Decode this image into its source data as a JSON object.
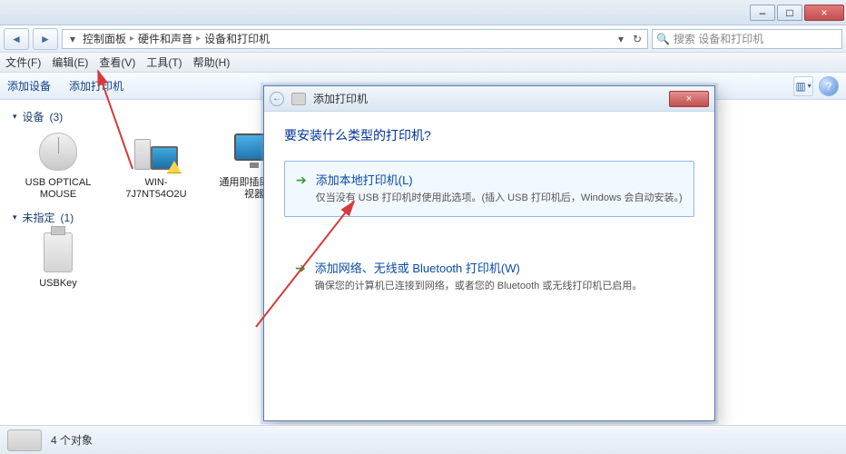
{
  "window": {
    "min": "–",
    "max": "□",
    "close": "×"
  },
  "nav": {
    "back": "◄",
    "fwd": "►",
    "crumbs": [
      "控制面板",
      "硬件和声音",
      "设备和打印机"
    ],
    "refresh": "↻",
    "search_placeholder": "搜索 设备和打印机"
  },
  "menu": [
    "文件(F)",
    "编辑(E)",
    "查看(V)",
    "工具(T)",
    "帮助(H)"
  ],
  "toolbar": {
    "add_device": "添加设备",
    "add_printer": "添加打印机",
    "view_icon": "▥",
    "help": "?"
  },
  "groups": {
    "devices": {
      "label": "设备",
      "count": "(3)"
    },
    "unspecified": {
      "label": "未指定",
      "count": "(1)"
    }
  },
  "devices": {
    "mouse": "USB OPTICAL MOUSE",
    "pc": "WIN-7J7NT54O2U",
    "monitor": "通用即插即用监视器",
    "usbkey": "USBKey"
  },
  "dialog": {
    "title": "添加打印机",
    "close": "×",
    "heading": "要安装什么类型的打印机?",
    "opt1_title": "添加本地打印机(L)",
    "opt1_desc": "仅当没有 USB 打印机时使用此选项。(插入 USB 打印机后，Windows 会自动安装。)",
    "opt2_title": "添加网络、无线或 Bluetooth 打印机(W)",
    "opt2_desc": "确保您的计算机已连接到网络，或者您的 Bluetooth 或无线打印机已启用。"
  },
  "status": {
    "count": "4 个对象"
  }
}
